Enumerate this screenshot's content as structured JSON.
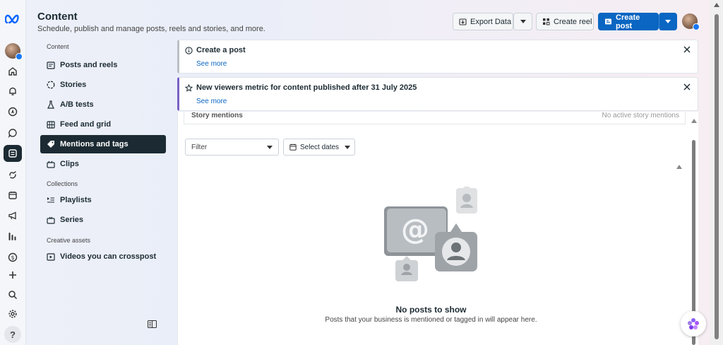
{
  "header": {
    "title": "Content",
    "subtitle": "Schedule, publish and manage posts, reels and stories, and more."
  },
  "toolbar": {
    "export_label": "Export Data",
    "create_reel_label": "Create reel",
    "create_post_label": "Create post"
  },
  "sidebar": {
    "section_content": "Content",
    "items_content": [
      {
        "label": "Posts and reels",
        "icon": "posts-icon"
      },
      {
        "label": "Stories",
        "icon": "stories-icon"
      },
      {
        "label": "A/B tests",
        "icon": "flask-icon"
      },
      {
        "label": "Feed and grid",
        "icon": "grid-icon"
      },
      {
        "label": "Mentions and tags",
        "icon": "tag-icon",
        "active": true
      },
      {
        "label": "Clips",
        "icon": "clips-icon"
      }
    ],
    "section_collections": "Collections",
    "items_collections": [
      {
        "label": "Playlists",
        "icon": "playlist-icon"
      },
      {
        "label": "Series",
        "icon": "series-icon"
      }
    ],
    "section_assets": "Creative assets",
    "items_assets": [
      {
        "label": "Videos you can crosspost",
        "icon": "video-icon"
      }
    ]
  },
  "banners": [
    {
      "title": "Create a post",
      "link": "See more",
      "icon": "info-icon",
      "accent": "#bcc0c4"
    },
    {
      "title": "New viewers metric for content published after 31 July 2025",
      "link": "See more",
      "icon": "star-icon",
      "accent": "#7b61c4"
    }
  ],
  "story_row": {
    "label": "Story mentions",
    "value": "No active story mentions"
  },
  "filters": {
    "filter_label": "Filter",
    "dates_label": "Select dates"
  },
  "empty_state": {
    "title": "No posts to show",
    "subtitle": "Posts that your business is mentioned or tagged in will appear here."
  },
  "colors": {
    "primary": "#0a66c2",
    "active_nav": "#1c2b33",
    "meta_blue": "#0866ff"
  }
}
